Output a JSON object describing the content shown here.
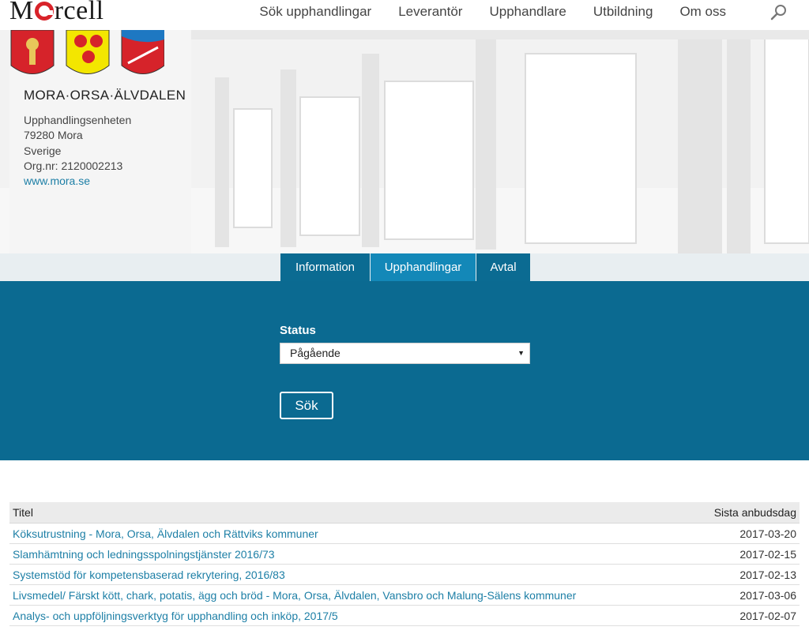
{
  "brand": {
    "logo_prefix": "M",
    "logo_suffix": "rcell"
  },
  "nav": {
    "items": [
      "Sök upphandlingar",
      "Leverantör",
      "Upphandlare",
      "Utbildning",
      "Om oss"
    ],
    "search_icon": "search-icon"
  },
  "org": {
    "name": "MORA·ORSA·ÄLVDALEN",
    "unit": "Upphandlingsenheten",
    "postal": "79280 Mora",
    "country": "Sverige",
    "orgnr": "Org.nr: 2120002213",
    "website": "www.mora.se"
  },
  "tabs": [
    "Information",
    "Upphandlingar",
    "Avtal"
  ],
  "filter": {
    "status_label": "Status",
    "status_value": "Pågående",
    "search_button": "Sök"
  },
  "table": {
    "headers": {
      "title": "Titel",
      "deadline": "Sista anbudsdag"
    },
    "rows": [
      {
        "title": "Köksutrustning - Mora, Orsa, Älvdalen och Rättviks kommuner",
        "date": "2017-03-20"
      },
      {
        "title": "Slamhämtning och ledningsspolningstjänster 2016/73",
        "date": "2017-02-15"
      },
      {
        "title": "Systemstöd för kompetensbaserad rekrytering, 2016/83",
        "date": "2017-02-13"
      },
      {
        "title": "Livsmedel/ Färskt kött, chark, potatis, ägg och bröd - Mora, Orsa, Älvdalen, Vansbro och Malung-Sälens kommuner",
        "date": "2017-03-06"
      },
      {
        "title": "Analys- och uppföljningsverktyg för upphandling och inköp, 2017/5",
        "date": "2017-02-07"
      }
    ]
  },
  "colors": {
    "accent": "#0b6a91",
    "tab_active": "#1388b8",
    "link": "#1d7fa6",
    "brand_red": "#d8232a"
  }
}
